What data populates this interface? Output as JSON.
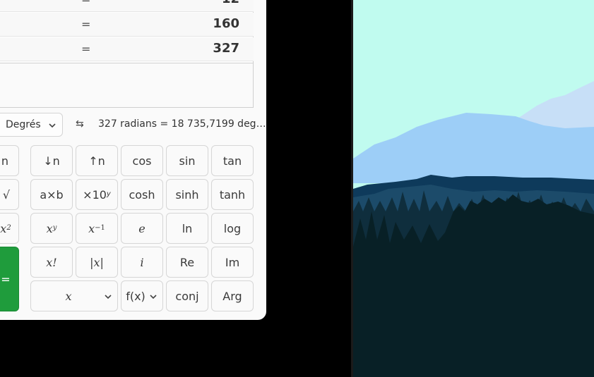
{
  "history": [
    {
      "equals": "=",
      "value": "12"
    },
    {
      "equals": "=",
      "value": "160"
    },
    {
      "equals": "=",
      "value": "327"
    }
  ],
  "status": {
    "angle_unit": "Degrés",
    "swap_icon": "⇆",
    "conversion": "327 radians  =  18 735,7199 deg…"
  },
  "keys": {
    "row1": [
      "n",
      "↓n",
      "↑n",
      "cos",
      "sin",
      "tan"
    ],
    "row2": [
      "√",
      "a×b",
      "×10",
      "cosh",
      "sinh",
      "tanh"
    ],
    "row2_sup": "y",
    "row3_base_x": "x",
    "row3_sup_2": "2",
    "row3_sup_y": "y",
    "row3_sup_m1": "−1",
    "row3_e": "e",
    "row3_ln": "ln",
    "row3_log": "log",
    "row4": [
      "x!",
      "|x|",
      "i",
      "Re",
      "Im"
    ],
    "equals": "=",
    "row5_variable": "x",
    "row5_function": "f(x)",
    "row5_conj": "conj",
    "row5_arg": "Arg"
  },
  "icons": {
    "chevron": "chevron-down-icon",
    "swap": "swap-icon"
  },
  "colors": {
    "equals_button": "#1f9c3c",
    "sky": "#c0fbef"
  }
}
